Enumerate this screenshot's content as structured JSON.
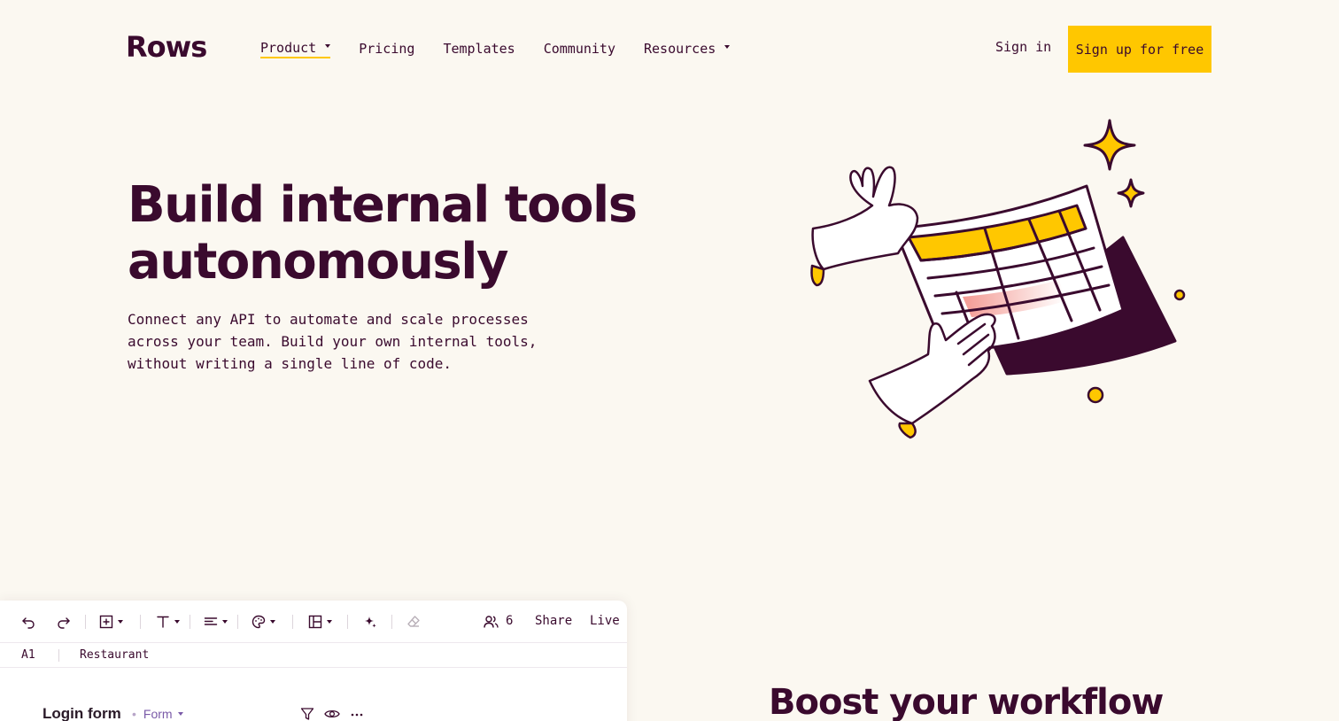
{
  "brand": {
    "logo": "Rows"
  },
  "nav": {
    "items": [
      {
        "label": "Product",
        "has_dropdown": true,
        "active": true
      },
      {
        "label": "Pricing",
        "has_dropdown": false
      },
      {
        "label": "Templates",
        "has_dropdown": false
      },
      {
        "label": "Community",
        "has_dropdown": false
      },
      {
        "label": "Resources",
        "has_dropdown": true
      }
    ],
    "sign_in": "Sign in",
    "sign_up": "Sign up for free"
  },
  "hero": {
    "title_line1": "Build internal tools",
    "title_line2": "autonomously",
    "subtitle": "Connect any API to automate and scale processes across your team. Build your own internal tools, without writing a single line of code.",
    "illustration": "hands-holding-spreadsheet-illustration"
  },
  "app_preview": {
    "toolbar": {
      "icons": [
        "undo-icon",
        "redo-icon",
        "insert-icon",
        "text-format-icon",
        "align-icon",
        "color-palette-icon",
        "layout-icon",
        "ai-sparkle-icon",
        "eraser-icon",
        "users-icon"
      ],
      "collaborators_count": "6",
      "share_label": "Share",
      "live_label": "Live"
    },
    "formula_bar": {
      "cell_ref": "A1",
      "cell_value": "Restaurant"
    },
    "table": {
      "title": "Login form",
      "type": "Form",
      "icons": [
        "filter-icon",
        "eye-icon",
        "more-icon"
      ]
    }
  },
  "section": {
    "title": "Boost your workflow"
  },
  "colors": {
    "background": "#fbf8f1",
    "text": "#3a0a2e",
    "accent": "#ffc700",
    "table_type": "#7a5aa8"
  }
}
